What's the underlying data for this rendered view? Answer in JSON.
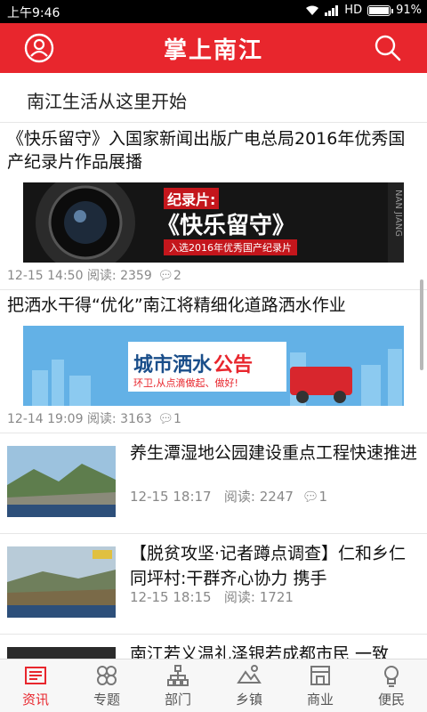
{
  "status": {
    "time": "上午9:46",
    "network": "HD",
    "battery": "91%",
    "battery_level": 0.91
  },
  "header": {
    "title": "掌上南江"
  },
  "slogan": "南江生活从这里开始",
  "news": [
    {
      "title": "《快乐留守》入国家新闻出版广电总局2016年优秀国产纪录片作品展播",
      "banner": {
        "label": "纪录片:",
        "main": "《快乐留守》",
        "sub": "入选2016年优秀国产纪录片",
        "side": "NAN JIANG"
      },
      "date": "12-15 14:50",
      "reads_label": "阅读:",
      "reads": "2359",
      "comments": "2"
    },
    {
      "title": "把洒水干得“优化”南江将精细化道路洒水作业",
      "banner": {
        "main_a": "城市洒水",
        "main_b": "公告",
        "sub": "环卫,从点滴做起、做好!"
      },
      "date": "12-14 19:09",
      "reads_label": "阅读:",
      "reads": "3163",
      "comments": "1"
    },
    {
      "title": "养生潭湿地公园建设重点工程快速推进",
      "date": "12-15 18:17",
      "reads_label": "阅读:",
      "reads": "2247",
      "comments": "1"
    },
    {
      "title": "【脱贫攻坚·记者蹲点调查】仁和乡仁同坪村:干群齐心协力 携手",
      "date": "12-15 18:15",
      "reads_label": "阅读:",
      "reads": "1721",
      "comments": ""
    },
    {
      "title": "南江若义温礼泽银若成都市民 一致",
      "date": "",
      "reads_label": "",
      "reads": "",
      "comments": ""
    }
  ],
  "nav": [
    {
      "label": "资讯",
      "icon": "news-icon",
      "active": true
    },
    {
      "label": "专题",
      "icon": "topics-icon",
      "active": false
    },
    {
      "label": "部门",
      "icon": "department-icon",
      "active": false
    },
    {
      "label": "乡镇",
      "icon": "township-icon",
      "active": false
    },
    {
      "label": "商业",
      "icon": "business-icon",
      "active": false
    },
    {
      "label": "便民",
      "icon": "convenience-icon",
      "active": false
    }
  ],
  "colors": {
    "brand": "#e8262d",
    "text": "#111111",
    "meta": "#888888"
  }
}
